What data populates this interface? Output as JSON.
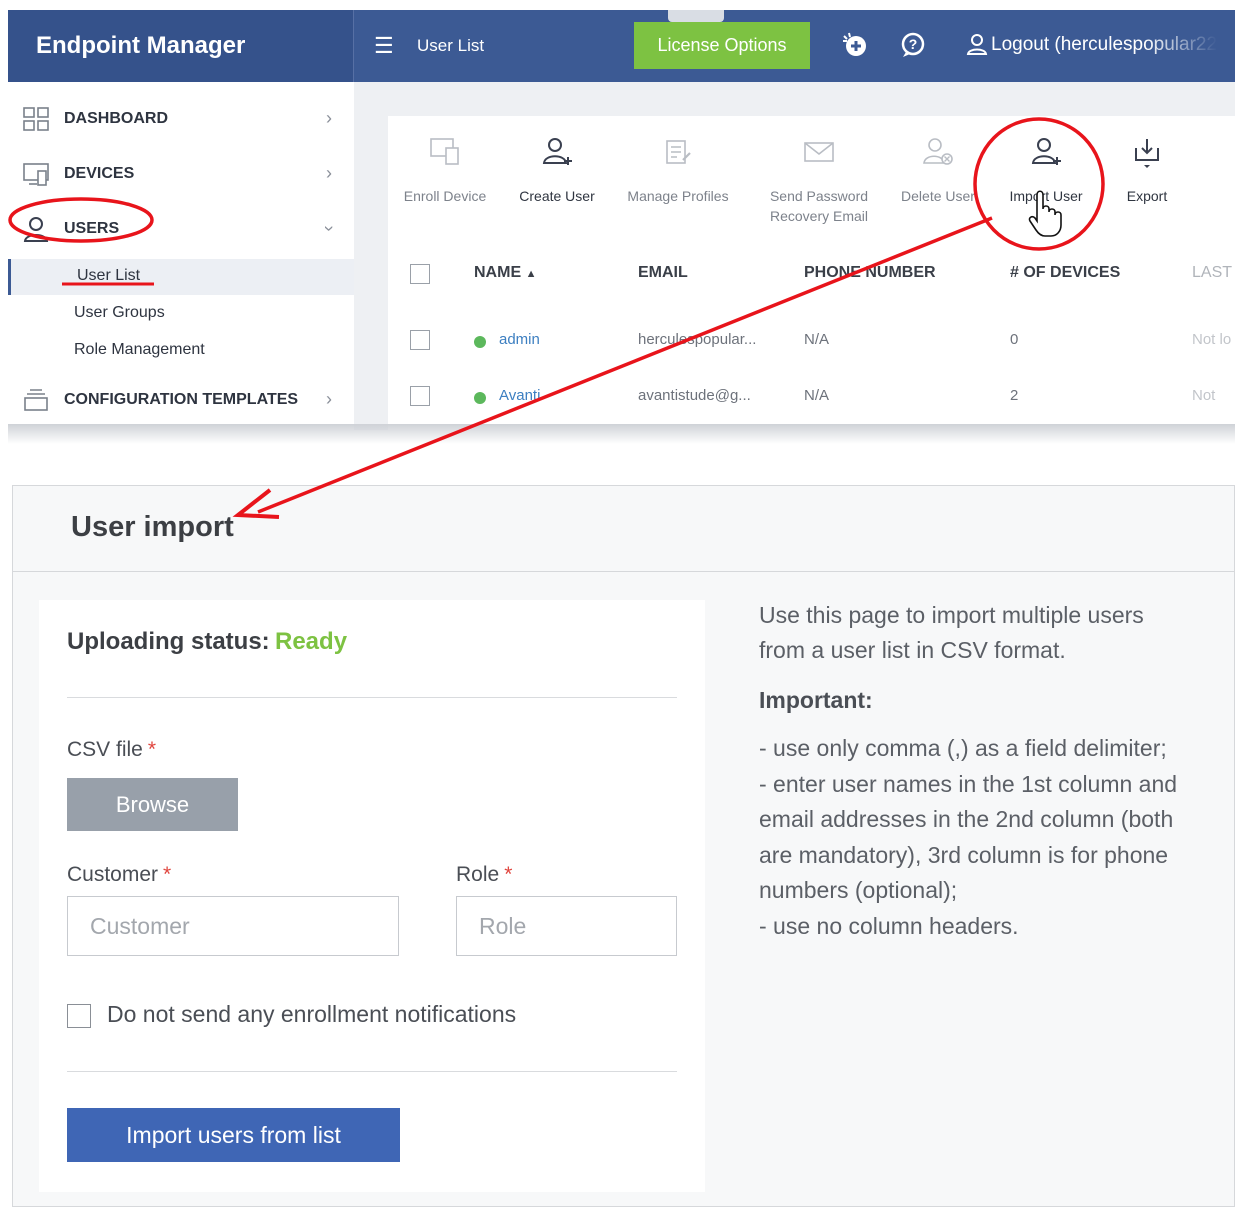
{
  "topbar": {
    "brand": "Endpoint Manager",
    "page_label": "User List",
    "license_button": "License Options",
    "logout_label": "Logout (herculespopular22"
  },
  "sidebar": {
    "items": [
      {
        "label": "DASHBOARD",
        "icon": "dashboard-icon"
      },
      {
        "label": "DEVICES",
        "icon": "devices-icon"
      },
      {
        "label": "USERS",
        "icon": "user-icon"
      },
      {
        "label": "CONFIGURATION TEMPLATES",
        "icon": "templates-icon"
      }
    ],
    "users_sub": [
      "User List",
      "User Groups",
      "Role Management"
    ]
  },
  "toolbar": {
    "enroll_device": "Enroll Device",
    "create_user": "Create User",
    "manage_profiles": "Manage Profiles",
    "send_password_line1": "Send Password",
    "send_password_line2": "Recovery Email",
    "delete_user": "Delete User",
    "import_user": "Import User",
    "export": "Export"
  },
  "table": {
    "columns": [
      "NAME",
      "EMAIL",
      "PHONE NUMBER",
      "# OF DEVICES",
      "LAST"
    ],
    "rows": [
      {
        "name": "admin",
        "email": "herculespopular...",
        "phone": "N/A",
        "devices": "0",
        "last": "Not lo"
      },
      {
        "name": "Avanti",
        "email": "avantistude@g...",
        "phone": "N/A",
        "devices": "2",
        "last": "Not"
      }
    ]
  },
  "import": {
    "title": "User import",
    "status_label": "Uploading status:",
    "status_value": "Ready",
    "csv_label": "CSV file",
    "required_mark": "*",
    "browse_label": "Browse",
    "customer_label": "Customer",
    "customer_placeholder": "Customer",
    "role_label": "Role",
    "role_placeholder": "Role",
    "notify_label": "Do not send any enrollment notifications",
    "submit_label": "Import users from list"
  },
  "help": {
    "intro_line1": "Use this page to import multiple users",
    "intro_line2": "from a user list in CSV format.",
    "important": "Important:",
    "lines": [
      "- use only comma (,) as a field delimiter;",
      "- enter user names in the 1st column and",
      "email addresses in the 2nd column (both",
      "are mandatory), 3rd column is for phone",
      "numbers (optional);",
      "- use no column headers."
    ]
  },
  "colors": {
    "brand_blue": "#3c5a94",
    "license_green": "#7dc242",
    "ready_green": "#7dc242",
    "annotation_red": "#e8141b",
    "primary_button": "#3f66b5"
  }
}
